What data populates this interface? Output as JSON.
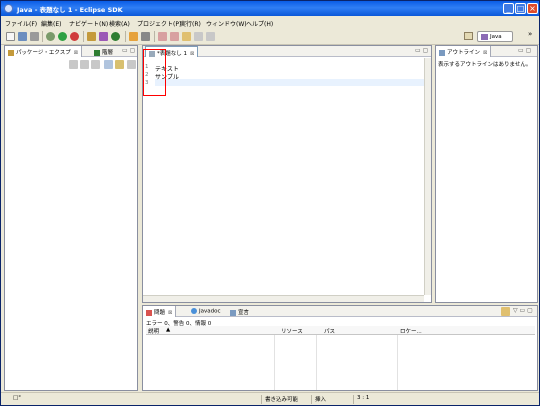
{
  "window": {
    "title": "Java - 表題なし 1 - Eclipse SDK",
    "controls": {
      "minimize": "_",
      "maximize": "□",
      "close": "×"
    }
  },
  "menubar": [
    "ファイル(F)",
    "編集(E)",
    "ナビゲート(N)",
    "検索(A)",
    "プロジェクト(P)",
    "実行(R)",
    "ウィンドウ(W)",
    "ヘルプ(H)"
  ],
  "toolbar": {
    "perspective": "Java",
    "chevron": "»"
  },
  "package_explorer": {
    "tab1": "パッケージ・エクスプ",
    "tab1_close": "⊠",
    "tab2": "階層",
    "controls": "▭ ▢"
  },
  "editor": {
    "tab": "*表題なし 1",
    "tab_close": "⊠",
    "controls": "▭ ▢",
    "lines": [
      {
        "num": "1",
        "text": "テキスト"
      },
      {
        "num": "2",
        "text": "サンプル"
      },
      {
        "num": "3",
        "text": ""
      }
    ]
  },
  "outline": {
    "tab": "アウトライン",
    "tab_close": "⊠",
    "controls": "▭ ▢",
    "message": "表示するアウトラインはありません。"
  },
  "problems": {
    "tab1": "問題",
    "tab1_close": "⊠",
    "tab2": "Javadoc",
    "tab3": "宣言",
    "controls": "▽ ▭ ▢",
    "summary": "エラー 0、警告 0、情報 0",
    "columns": [
      "説明",
      "リソース",
      "パス",
      "ロケー..."
    ],
    "sort_indicator": "▲"
  },
  "statusbar": {
    "left_icon": "□°",
    "writable": "書き込み可能",
    "insert_mode": "挿入",
    "position": "3 : 1"
  },
  "colors": {
    "titlebar": "#0a5ce6",
    "frame": "#ece9d8",
    "current_line": "#e8f2fe",
    "highlight_box": "#ff0000"
  }
}
